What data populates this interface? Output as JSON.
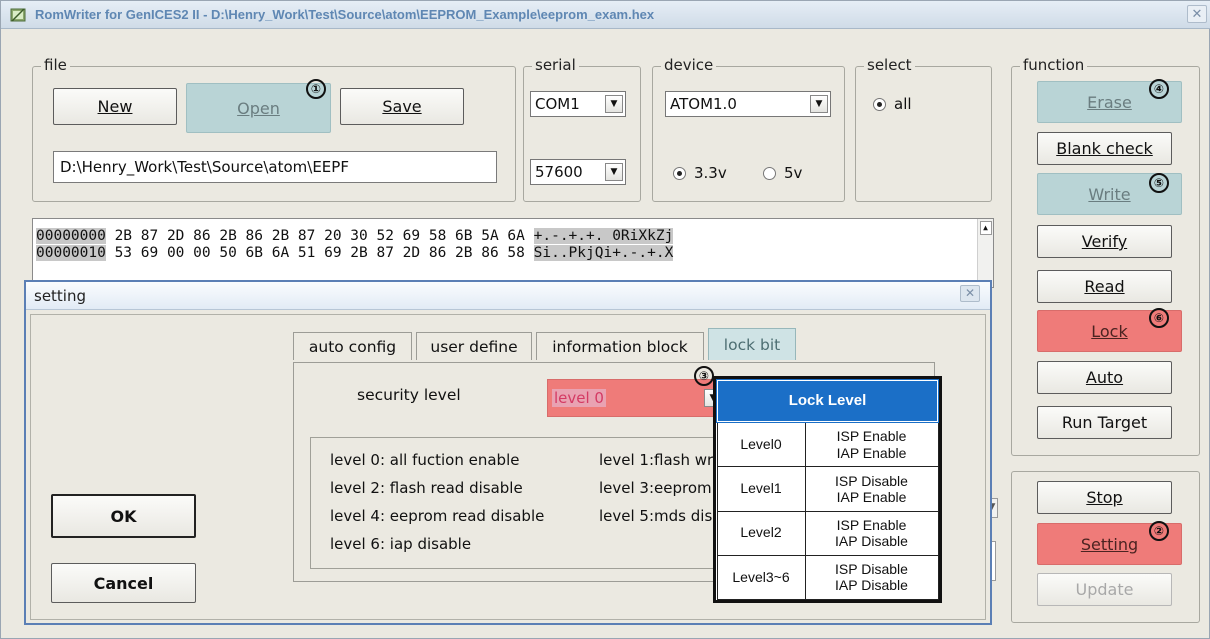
{
  "window": {
    "title": "RomWriter for GenICES2 II - D:\\Henry_Work\\Test\\Source\\atom\\EEPROM_Example\\eeprom_exam.hex",
    "close_icon": "close-icon"
  },
  "file": {
    "group_label": "file",
    "new_label": "New",
    "open_label": "Open",
    "save_label": "Save",
    "path_value": "D:\\Henry_Work\\Test\\Source\\atom\\EEPF"
  },
  "serial": {
    "group_label": "serial",
    "port_value": "COM1",
    "baud_value": "57600"
  },
  "device": {
    "group_label": "device",
    "device_value": "ATOM1.0",
    "voltage_options": [
      "3.3v",
      "5v"
    ],
    "voltage_selected": "3.3v"
  },
  "select": {
    "group_label": "select",
    "option_all": "all"
  },
  "function": {
    "group_label": "function",
    "buttons": [
      "Erase",
      "Blank check",
      "Write",
      "Verify",
      "Read",
      "Lock",
      "Auto",
      "Run Target"
    ],
    "lower_buttons": [
      "Stop",
      "Setting",
      "Update"
    ]
  },
  "badges": [
    "①",
    "②",
    "③",
    "④",
    "⑤",
    "⑥"
  ],
  "hex": {
    "rows": [
      {
        "addr": "00000000",
        "bytes": "2B 87 2D 86 2B 86 2B 87 20 30 52 69 58 6B 5A 6A",
        "ascii": "+.-.+.+. 0RiXkZj"
      },
      {
        "addr": "00000010",
        "bytes": "53 69 00 00 50 6B 6A 51 69 2B 87 2D 86 2B 86 58",
        "ascii": "Si..PkjQi+.-.+.X"
      }
    ]
  },
  "setting_dialog": {
    "title": "setting",
    "ok_label": "OK",
    "cancel_label": "Cancel",
    "tabs": [
      "auto config",
      "user define",
      "information block",
      "lock bit"
    ],
    "active_tab": "lock bit",
    "security_label": "security level",
    "security_value": "level 0",
    "levels": [
      "level 0: all fuction enable",
      "level 1:flash wr",
      "level 2: flash read disable",
      "level 3:eeprom",
      "level 4: eeprom read disable",
      "level 5:mds dis",
      "level 6: iap disable"
    ]
  },
  "lock_table": {
    "header": "Lock Level",
    "rows": [
      {
        "level": "Level0",
        "isp": "ISP Enable",
        "iap": "IAP Enable"
      },
      {
        "level": "Level1",
        "isp": "ISP Disable",
        "iap": "IAP Enable"
      },
      {
        "level": "Level2",
        "isp": "ISP Enable",
        "iap": "IAP Disable"
      },
      {
        "level": "Level3~6",
        "isp": "ISP Disable",
        "iap": "IAP Disable"
      }
    ]
  },
  "colors": {
    "highlight_teal": "#b9d4d6",
    "highlight_red": "#ef7b79",
    "lock_header_blue": "#1b6fc7"
  }
}
